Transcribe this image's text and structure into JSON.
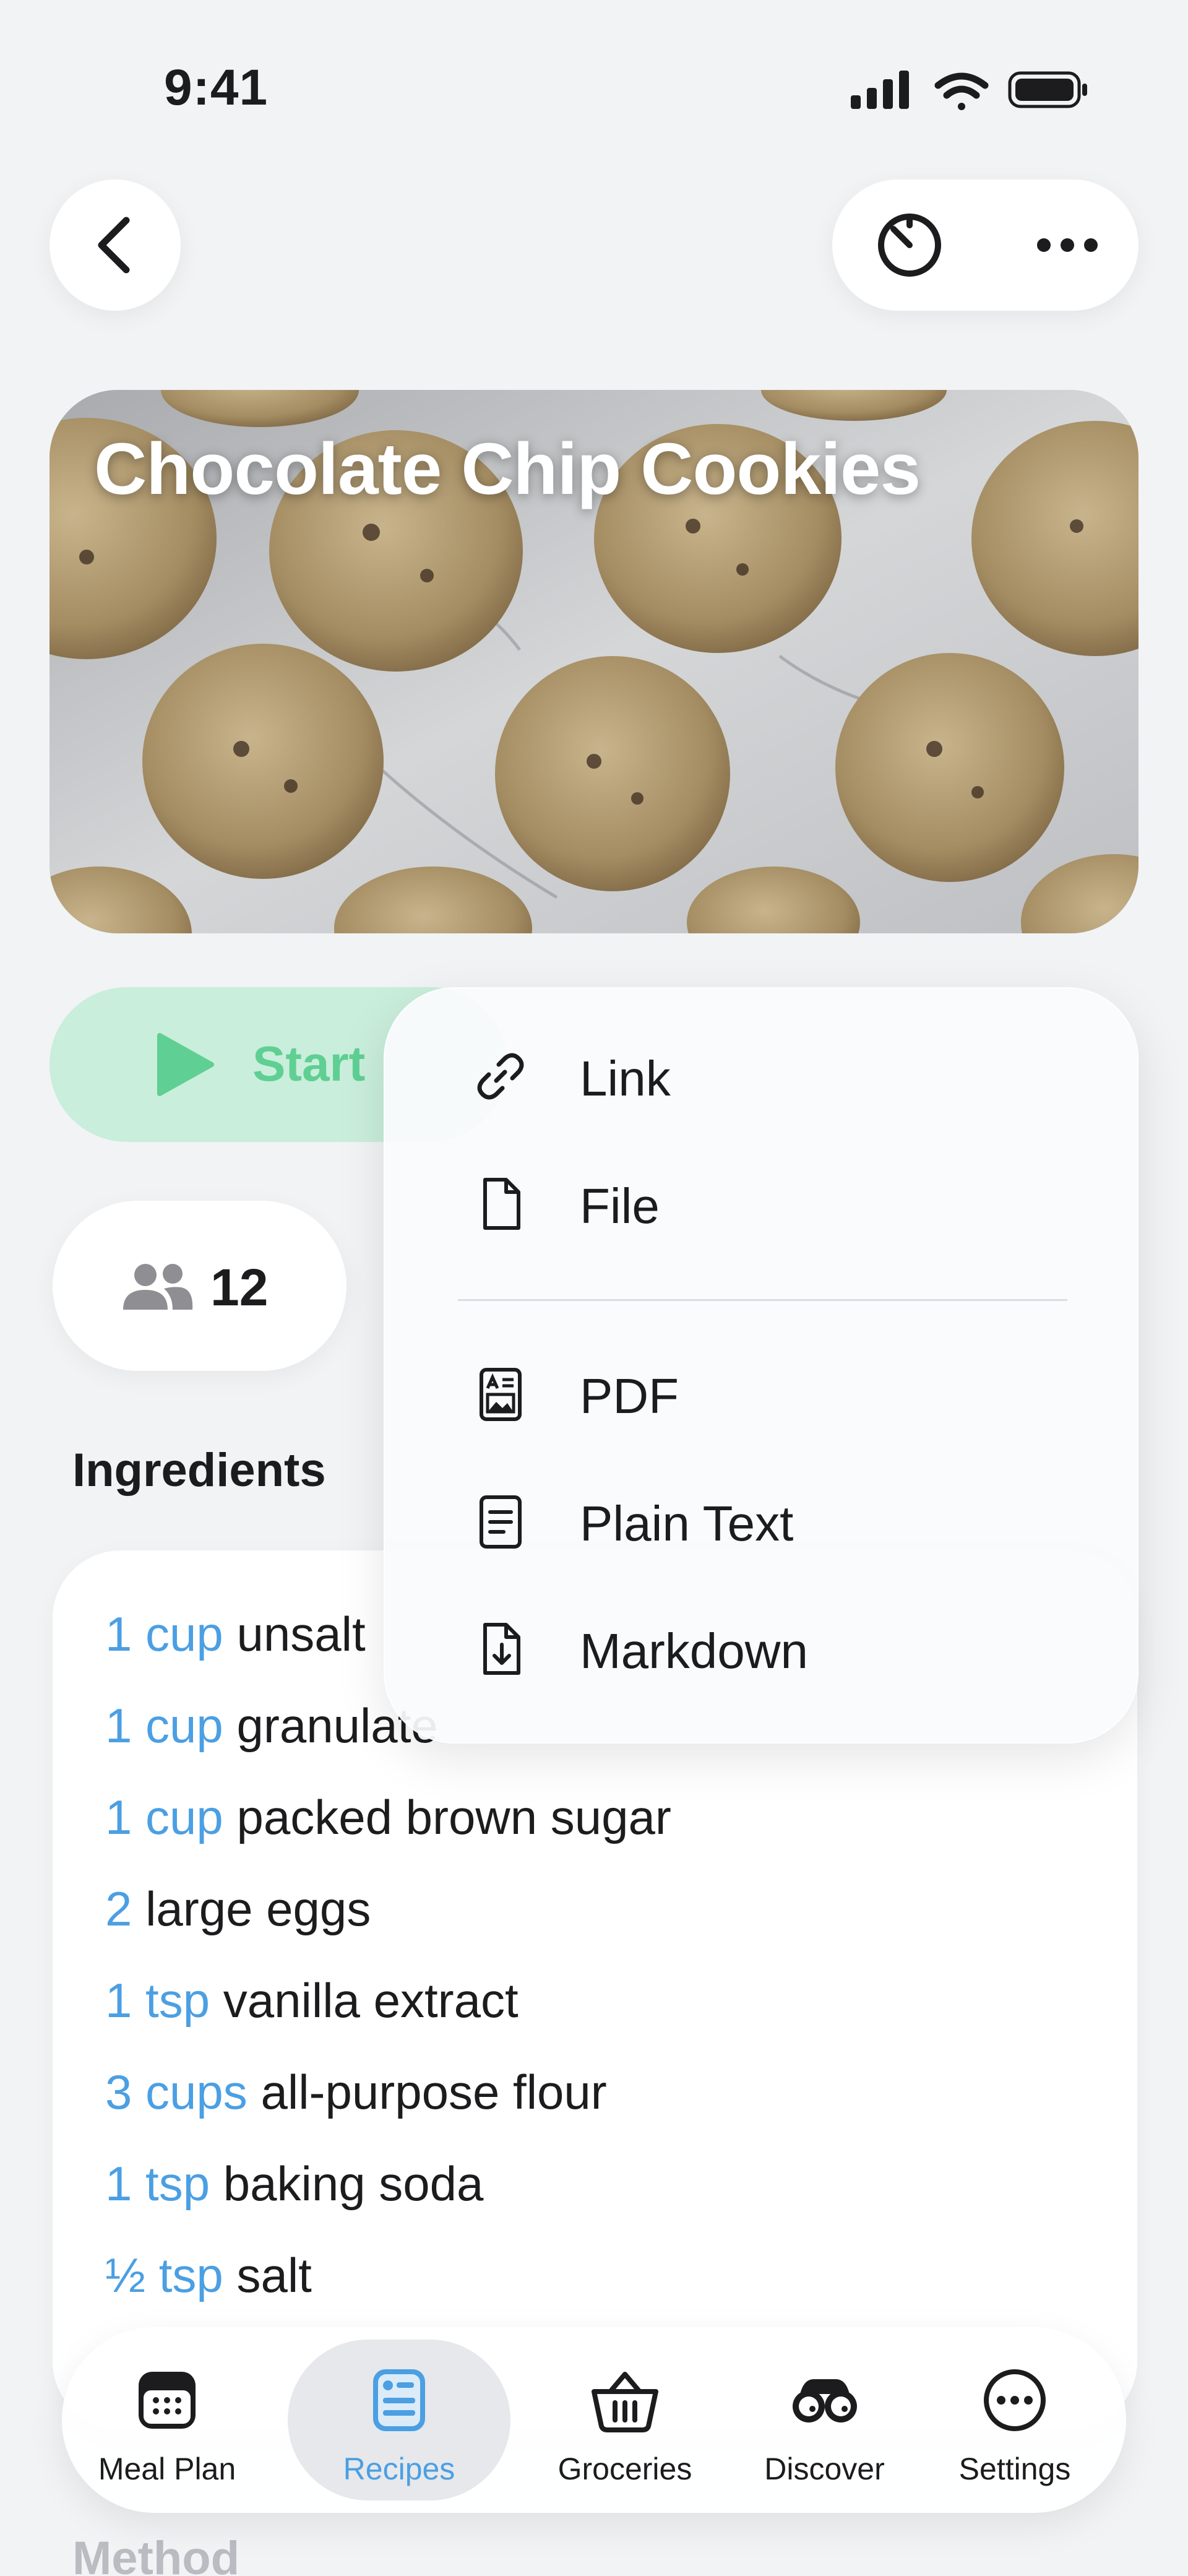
{
  "status_bar": {
    "time": "9:41"
  },
  "recipe": {
    "title": "Chocolate Chip Cookies"
  },
  "actions": {
    "start_label": "Start"
  },
  "servings": {
    "count": "12"
  },
  "ingredients": {
    "heading": "Ingredients",
    "items": [
      {
        "qty": "1 cup",
        "name": "unsalt"
      },
      {
        "qty": "1 cup",
        "name": "granulate"
      },
      {
        "qty": "1 cup",
        "name": "packed brown sugar"
      },
      {
        "qty": "2",
        "name": "large eggs"
      },
      {
        "qty": "1 tsp",
        "name": "vanilla extract"
      },
      {
        "qty": "3 cups",
        "name": "all-purpose flour"
      },
      {
        "qty": "1 tsp",
        "name": "baking soda"
      },
      {
        "qty": "½ tsp",
        "name": "salt"
      }
    ]
  },
  "method": {
    "heading": "Method"
  },
  "share_menu": {
    "items": [
      {
        "label": "Link",
        "icon": "link-icon"
      },
      {
        "label": "File",
        "icon": "file-icon"
      },
      {
        "label": "PDF",
        "icon": "pdf-icon"
      },
      {
        "label": "Plain Text",
        "icon": "plain-text-icon"
      },
      {
        "label": "Markdown",
        "icon": "markdown-icon"
      }
    ]
  },
  "tabbar": {
    "tabs": [
      {
        "label": "Meal Plan",
        "icon": "calendar-icon"
      },
      {
        "label": "Recipes",
        "icon": "recipe-card-icon",
        "active": true
      },
      {
        "label": "Groceries",
        "icon": "basket-icon"
      },
      {
        "label": "Discover",
        "icon": "binoculars-icon"
      },
      {
        "label": "Settings",
        "icon": "ellipsis-circle-icon"
      }
    ]
  },
  "colors": {
    "accent": "#4b9fe3",
    "start_green": "#5fcf93",
    "start_bg": "#c9eedb",
    "background": "#f1f3f5"
  }
}
